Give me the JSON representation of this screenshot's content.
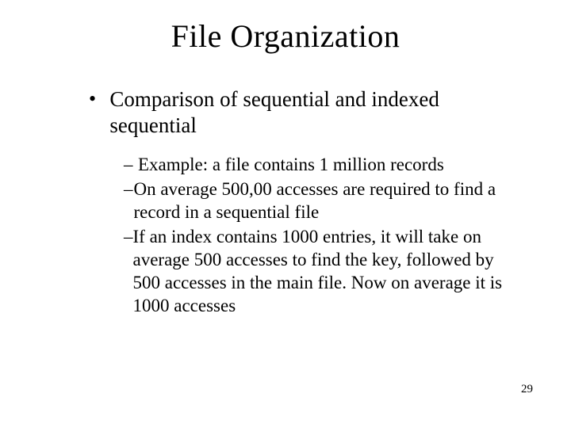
{
  "title": "File Organization",
  "bullet_main": "Comparison of sequential and indexed sequential",
  "sub": [
    "Example: a file contains 1 million records",
    "On average 500,00 accesses are required to find a record in a sequential file",
    "If an index contains 1000 entries, it will take on average 500 accesses to find the key, followed by 500 accesses in the main file. Now on average it is 1000 accesses"
  ],
  "page_number": "29"
}
